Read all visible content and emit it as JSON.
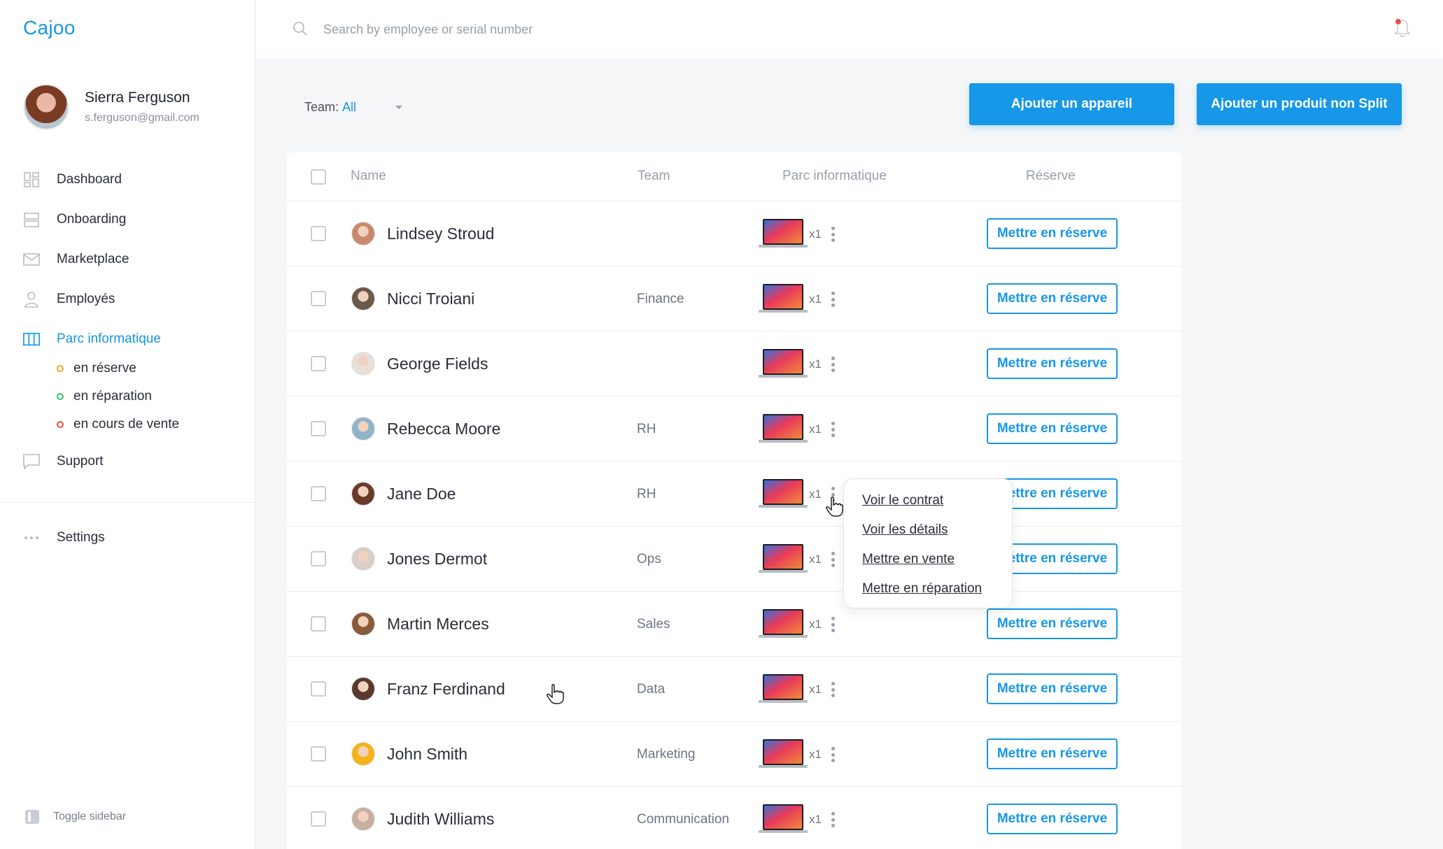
{
  "app": {
    "logo": "Cajoo"
  },
  "user": {
    "name": "Sierra Ferguson",
    "email": "s.ferguson@gmail.com"
  },
  "nav": {
    "items": [
      {
        "label": "Dashboard",
        "icon": "dashboard-icon"
      },
      {
        "label": "Onboarding",
        "icon": "onboarding-icon"
      },
      {
        "label": "Marketplace",
        "icon": "mail-icon"
      },
      {
        "label": "Employés",
        "icon": "user-icon"
      },
      {
        "label": "Parc informatique",
        "icon": "columns-icon",
        "active": true
      }
    ],
    "sub_items": [
      {
        "label": "en réserve",
        "color": "#f5a623"
      },
      {
        "label": "en réparation",
        "color": "#3ac45e"
      },
      {
        "label": "en cours de vente",
        "color": "#f04a4a"
      }
    ],
    "support": "Support",
    "settings": "Settings",
    "toggle": "Toggle sidebar"
  },
  "search": {
    "placeholder": "Search by employee or serial number"
  },
  "filter": {
    "label": "Team:",
    "value": "All"
  },
  "buttons": {
    "add_device": "Ajouter un appareil",
    "add_non_split": "Ajouter un produit non Split"
  },
  "table": {
    "headers": {
      "name": "Name",
      "team": "Team",
      "parc": "Parc informatique",
      "reserve": "Réserve"
    },
    "rows": [
      {
        "name": "Lindsey Stroud",
        "team": "",
        "count": "x1",
        "action": "Mettre en réserve"
      },
      {
        "name": "Nicci Troiani",
        "team": "Finance",
        "count": "x1",
        "action": "Mettre en réserve"
      },
      {
        "name": "George Fields",
        "team": "",
        "count": "x1",
        "action": "Mettre en réserve"
      },
      {
        "name": "Rebecca Moore",
        "team": "RH",
        "count": "x1",
        "action": "Mettre en réserve"
      },
      {
        "name": "Jane Doe",
        "team": "RH",
        "count": "x1",
        "action": "Mettre en réserve"
      },
      {
        "name": "Jones Dermot",
        "team": "Ops",
        "count": "x1",
        "action": "Mettre en réserve"
      },
      {
        "name": "Martin Merces",
        "team": "Sales",
        "count": "x1",
        "action": "Mettre en réserve"
      },
      {
        "name": "Franz Ferdinand",
        "team": "Data",
        "count": "x1",
        "action": "Mettre en réserve"
      },
      {
        "name": "John Smith",
        "team": "Marketing",
        "count": "x1",
        "action": "Mettre en réserve"
      },
      {
        "name": "Judith Williams",
        "team": "Communication",
        "count": "x1",
        "action": "Mettre en réserve"
      }
    ]
  },
  "context_menu": {
    "items": [
      "Voir le contrat",
      "Voir les détails",
      "Mettre en vente",
      "Mettre en réparation"
    ]
  },
  "colors": {
    "accent": "#1697e8",
    "notification": "#f04a4a"
  }
}
